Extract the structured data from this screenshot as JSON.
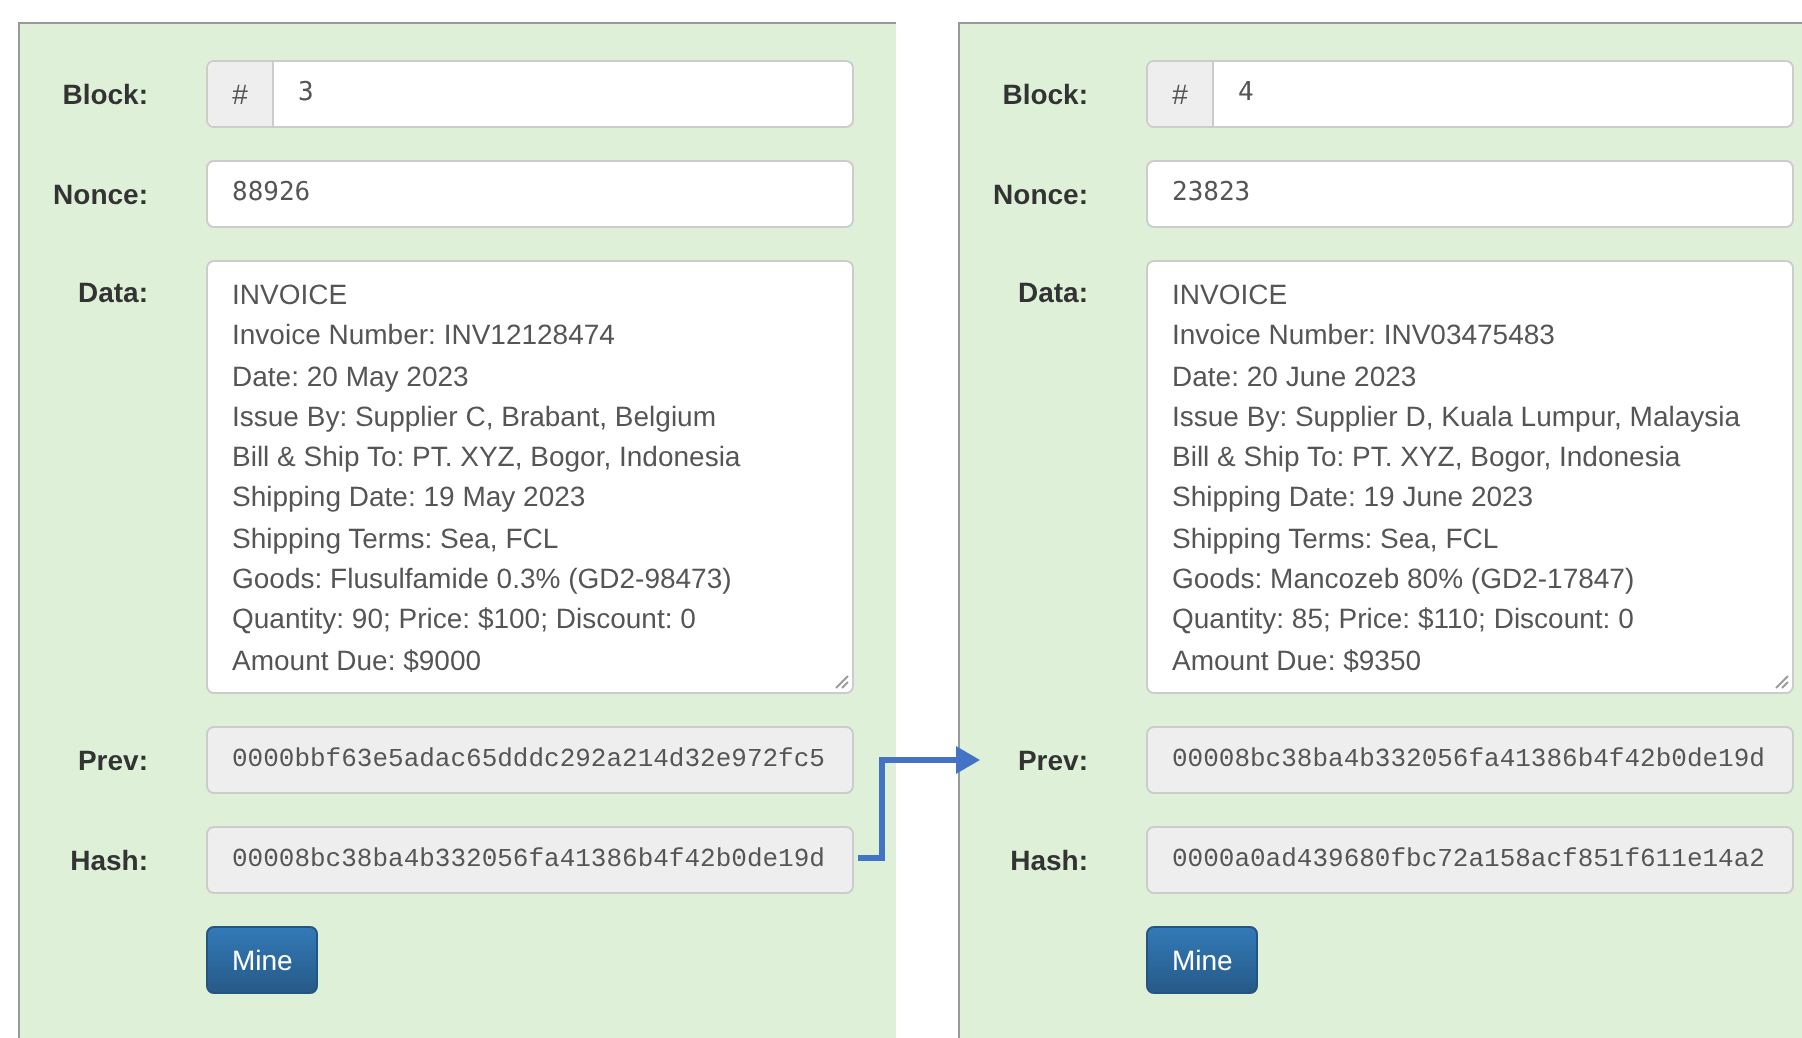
{
  "blocks": [
    {
      "block_label": "Block:",
      "block_prefix": "#",
      "block": "3",
      "nonce_label": "Nonce:",
      "nonce": "88926",
      "data_label": "Data:",
      "data": [
        "INVOICE",
        "Invoice Number: INV12128474",
        "Date: 20 May 2023",
        "Issue By: Supplier C, Brabant, Belgium",
        "Bill & Ship To: PT. XYZ, Bogor, Indonesia",
        "Shipping Date: 19 May 2023",
        "Shipping Terms: Sea, FCL",
        "Goods: Flusulfamide 0.3% (GD2-98473)",
        "Quantity: 90; Price: $100; Discount: 0",
        "Amount Due: $9000"
      ],
      "prev_label": "Prev:",
      "prev": "0000bbf63e5adac65dddc292a214d32e972fc5",
      "hash_label": "Hash:",
      "hash": "00008bc38ba4b332056fa41386b4f42b0de19d",
      "button": "Mine"
    },
    {
      "block_label": "Block:",
      "block_prefix": "#",
      "block": "4",
      "nonce_label": "Nonce:",
      "nonce": "23823",
      "data_label": "Data:",
      "data": [
        "INVOICE",
        "Invoice Number: INV03475483",
        "Date: 20 June 2023",
        "Issue By: Supplier D, Kuala Lumpur, Malaysia",
        "Bill & Ship To: PT. XYZ, Bogor, Indonesia",
        "Shipping Date: 19 June 2023",
        "Shipping Terms: Sea, FCL",
        "Goods: Mancozeb 80% (GD2-17847)",
        "Quantity: 85; Price: $110; Discount: 0",
        "Amount Due: $9350"
      ],
      "prev_label": "Prev:",
      "prev": "00008bc38ba4b332056fa41386b4f42b0de19d",
      "hash_label": "Hash:",
      "hash": "0000a0ad439680fbc72a158acf851f611e14a2",
      "button": "Mine"
    }
  ]
}
